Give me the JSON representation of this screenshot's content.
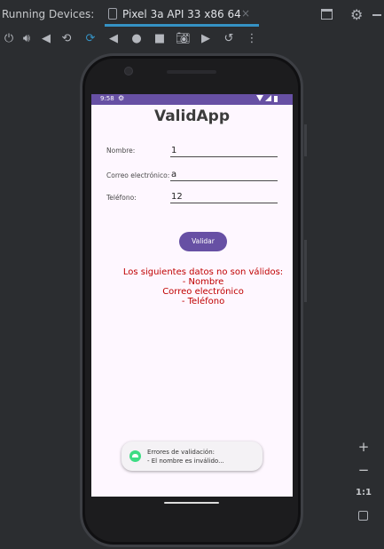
{
  "panel": {
    "title": "Running Devices:",
    "tab_label": "Pixel 3a API 33 x86 64",
    "tab_close": "×"
  },
  "toolbar": {
    "icons": [
      "power-icon",
      "volume-up-icon",
      "volume-down-icon",
      "rotate-left-icon",
      "rotate-right-icon",
      "back-icon",
      "home-icon",
      "overview-icon",
      "camera-icon",
      "record-icon",
      "restore-icon",
      "more-icon"
    ]
  },
  "device": {
    "status_time": "9:58",
    "app_title": "ValidApp",
    "form": {
      "name_label": "Nombre:",
      "name_value": "1",
      "email_label": "Correo electrónico:",
      "email_value": "a",
      "phone_label": "Teléfono:",
      "phone_value": "12"
    },
    "validate_button": "Validar",
    "errors": {
      "heading": "Los siguientes datos no son válidos:",
      "items": [
        "- Nombre",
        "Correo electrónico",
        "- Teléfono"
      ]
    },
    "toast": {
      "line1": "Errores de validación:",
      "line2": "- El nombre es inválido..."
    }
  },
  "zoom": {
    "zoom_in": "+",
    "zoom_out": "−",
    "actual_size": "1:1"
  },
  "colors": {
    "accent": "#6750a4",
    "error": "#c00000",
    "tab_underline": "#3592c4",
    "background": "#2b2d30"
  }
}
